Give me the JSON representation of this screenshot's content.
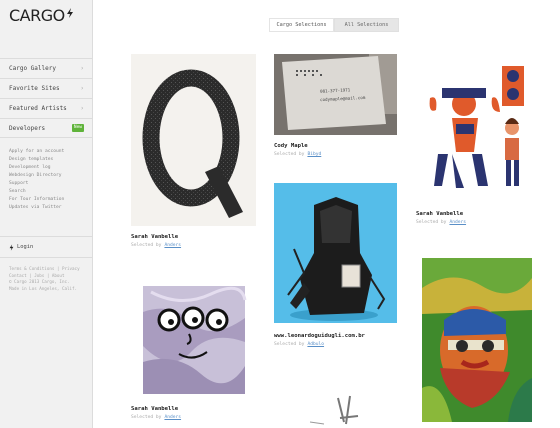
{
  "app": {
    "logo_text": "CARGO",
    "brand_green": "#5fb33a"
  },
  "sidebar": {
    "nav": [
      {
        "label": "Cargo Gallery",
        "icon": "chevron-right-icon"
      },
      {
        "label": "Favorite Sites",
        "icon": "chevron-right-icon"
      },
      {
        "label": "Featured Artists",
        "icon": "chevron-right-icon"
      },
      {
        "label": "Developers",
        "badge": "New"
      }
    ],
    "links": [
      "Apply for an account",
      "Design templates",
      "Development log",
      "Webdesign Directory",
      "Support",
      "Search",
      "For Tour Information",
      "Updates via Twitter"
    ],
    "login_label": "Login",
    "footer": [
      "Terms & Conditions | Privacy",
      "Contact | Jobs | About",
      "© Cargo 2013 Cargo, Inc.",
      "Made in Los Angeles, Calif."
    ]
  },
  "tabs": {
    "active": "Cargo Selections",
    "inactive": "All Selections"
  },
  "grid": [
    {
      "title": "Sarah Vanbelle",
      "by": "Selected by",
      "curator": "Anders"
    },
    {
      "title": "Cody Maple",
      "by": "Selected by",
      "curator": "Bibyd"
    },
    {
      "title": "Sarah Vanbelle",
      "by": "Selected by",
      "curator": "Anders"
    },
    {
      "title": "www.leonardoguidugli.com.br",
      "by": "Selected by",
      "curator": "Adbulo"
    },
    {
      "title": "Sarah Vanbelle",
      "by": "Selected by",
      "curator": "Anders"
    }
  ],
  "card_text": {
    "phone": "081-377-1971",
    "email": "codymaple@mail.com"
  }
}
